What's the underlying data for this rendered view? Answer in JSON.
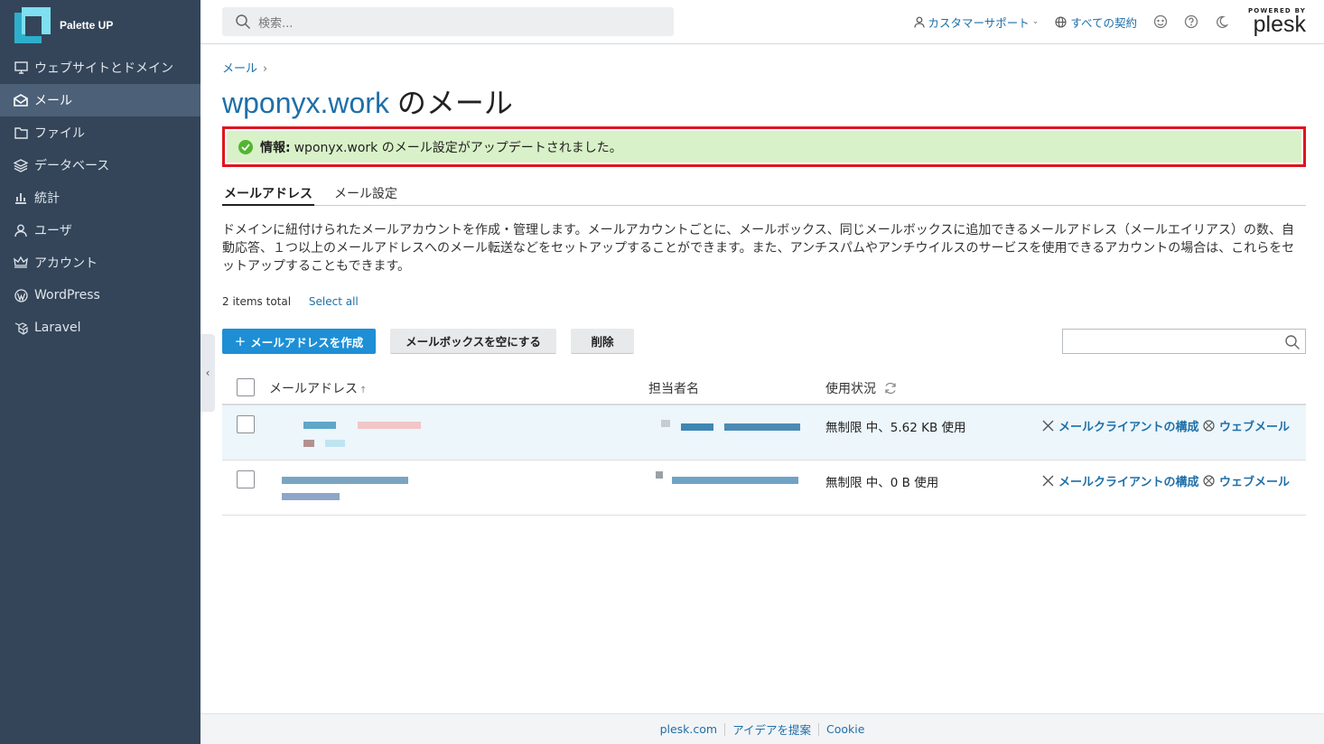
{
  "brand": {
    "name": "Palette UP"
  },
  "sidebar": {
    "items": [
      {
        "label": "ウェブサイトとドメイン",
        "icon": "monitor-icon"
      },
      {
        "label": "メール",
        "icon": "mail-icon",
        "active": true
      },
      {
        "label": "ファイル",
        "icon": "folder-icon"
      },
      {
        "label": "データベース",
        "icon": "database-icon"
      },
      {
        "label": "統計",
        "icon": "stats-icon"
      },
      {
        "label": "ユーザ",
        "icon": "user-icon"
      },
      {
        "label": "アカウント",
        "icon": "crown-icon"
      },
      {
        "label": "WordPress",
        "icon": "wordpress-icon"
      },
      {
        "label": "Laravel",
        "icon": "laravel-icon"
      }
    ]
  },
  "header": {
    "search_placeholder": "検索...",
    "support_label": "カスタマーサポート",
    "subscriptions_label": "すべての契約",
    "powered_by": "POWERED BY",
    "plesk": "plesk"
  },
  "breadcrumb": {
    "item": "メール",
    "sep": "›"
  },
  "page": {
    "title_domain": "wponyx.work",
    "title_suffix": "のメール"
  },
  "alert": {
    "label": "情報:",
    "text": "wponyx.work のメール設定がアップデートされました。"
  },
  "tabs": [
    {
      "label": "メールアドレス"
    },
    {
      "label": "メール設定"
    }
  ],
  "description": "ドメインに紐付けられたメールアカウントを作成・管理します。メールアカウントごとに、メールボックス、同じメールボックスに追加できるメールアドレス（メールエイリアス）の数、自動応答、１つ以上のメールアドレスへのメール転送などをセットアップすることができます。また、アンチスパムやアンチウイルスのサービスを使用できるアカウントの場合は、これらをセットアップすることもできます。",
  "list": {
    "items_total": "2 items total",
    "select_all": "Select all",
    "buttons": {
      "create": "メールアドレスを作成",
      "create_plus": "+",
      "empty": "メールボックスを空にする",
      "delete": "削除"
    },
    "search_value": "",
    "columns": {
      "email": "メールアドレス",
      "sort_arrow": "↑",
      "owner": "担当者名",
      "usage": "使用状況"
    },
    "rows": [
      {
        "usage": "無制限 中、5.62 KB 使用",
        "action_client": "メールクライアントの構成",
        "action_webmail": "ウェブメール"
      },
      {
        "usage": "無制限 中、0 B 使用",
        "action_client": "メールクライアントの構成",
        "action_webmail": "ウェブメール"
      }
    ]
  },
  "footer": {
    "links": [
      "plesk.com",
      "アイデアを提案",
      "Cookie"
    ]
  },
  "colors": {
    "sidebar": "#344559",
    "accent": "#1e8fd5",
    "link": "#1e6fa8",
    "alert_bg": "#d9f1c8",
    "alert_border": "#e0141e"
  }
}
